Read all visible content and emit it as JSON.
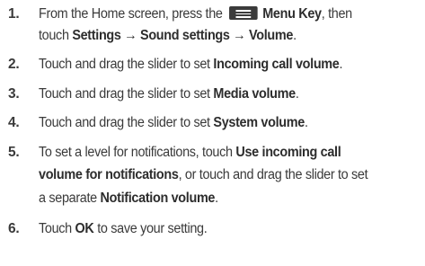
{
  "steps": [
    {
      "num": "1.",
      "lines": [
        {
          "a": "From the Home screen, press the",
          "key": "Menu Key",
          "b": ", then"
        },
        {
          "a": "touch",
          "path": "Settings  → Sound settings → Volume",
          "end": "."
        }
      ]
    },
    {
      "num": "2.",
      "text": "Touch and drag the slider to set",
      "bold": "Incoming call volume",
      "end": "."
    },
    {
      "num": "3.",
      "text": "Touch and drag the slider to set",
      "bold": "Media volume",
      "end": "."
    },
    {
      "num": "4.",
      "text": "Touch and drag the slider to set",
      "bold": "System volume",
      "end": "."
    },
    {
      "num": "5.",
      "lines": [
        {
          "a": "To set a level for notifications, touch",
          "bold": "Use incoming call"
        },
        {
          "bold": "volume for notifications",
          "b": ", or touch and drag the slider to set"
        },
        {
          "a": "a separate",
          "bold": "Notification volume",
          "end": "."
        }
      ]
    },
    {
      "num": "6.",
      "a": "Touch",
      "bold": "OK",
      "b": "to save your setting."
    }
  ],
  "icons": {
    "menu_key": "menu-key-icon"
  }
}
